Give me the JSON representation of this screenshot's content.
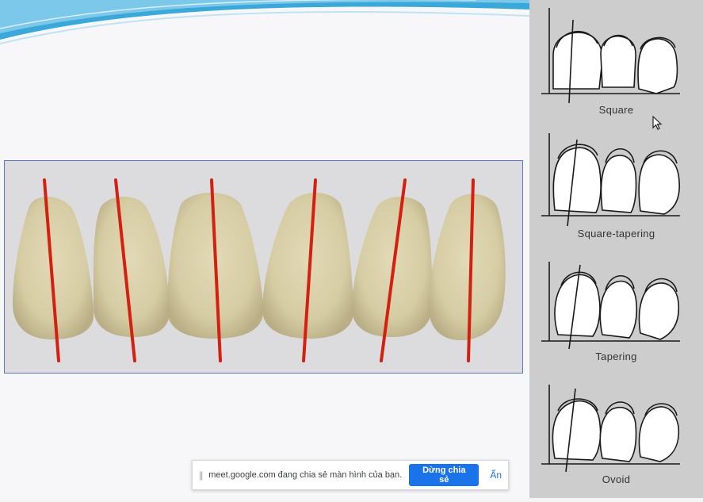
{
  "tooth_shape_panel": {
    "labels": [
      "Square",
      "Square-tapering",
      "Tapering",
      "Ovoid"
    ]
  },
  "screen_share_bar": {
    "grip": "||",
    "message": "meet.google.com đang chia sẻ màn hình của bạn.",
    "stop_button": "Dừng chia sẻ",
    "hide_link": "Ẩn"
  },
  "colors": {
    "axis_line": "#d42010",
    "photo_border": "#5b77c2",
    "share_button": "#1a73e8",
    "tooth_fill": "#d8cfa8"
  },
  "photo_teeth_count": 6
}
